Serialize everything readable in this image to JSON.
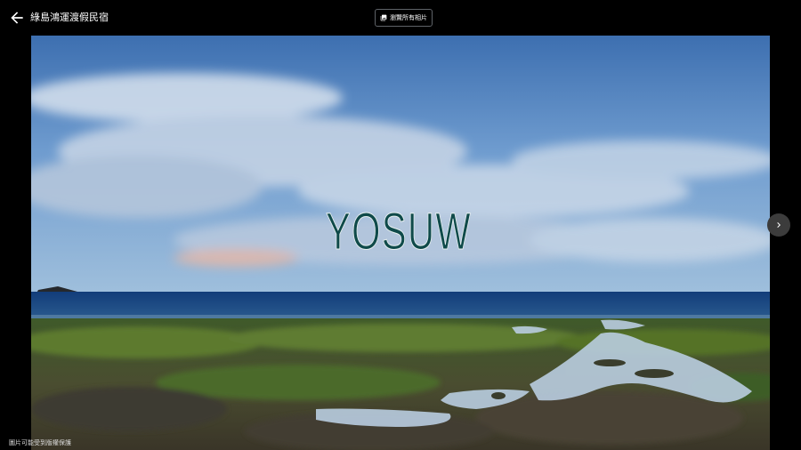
{
  "header": {
    "title": "綠島鴻運渡假民宿",
    "view_all_label": "瀏覽所有相片"
  },
  "photo": {
    "watermark_text": "YOSUW"
  },
  "footer": {
    "attribution": "圖片可能受到版權保護"
  },
  "icons": {
    "back": "arrow-left-icon",
    "gallery": "photo-library-icon",
    "next": "chevron-right-icon"
  },
  "colors": {
    "background": "#000000",
    "button_border": "#5f6368",
    "watermark": "#0f4a4a"
  }
}
